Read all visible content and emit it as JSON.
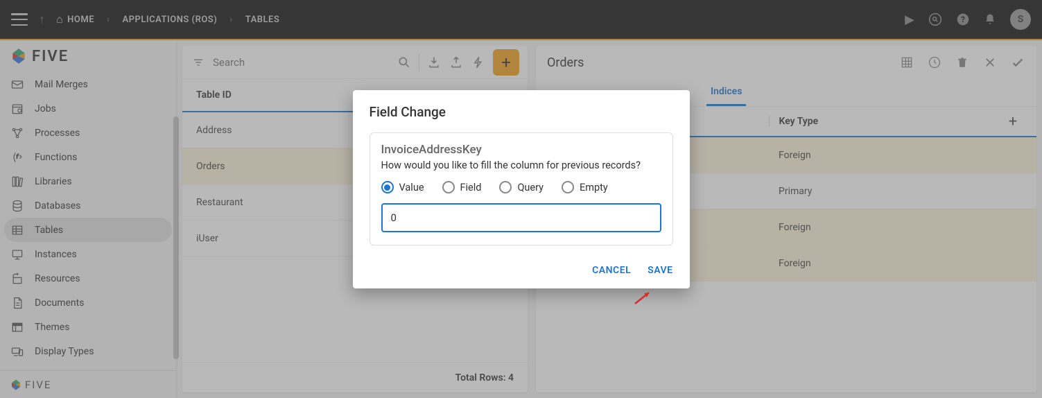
{
  "topbar": {
    "home_label": "HOME",
    "app_label": "APPLICATIONS (ROS)",
    "tables_label": "TABLES",
    "avatar_initial": "S"
  },
  "brand": {
    "name": "FIVE"
  },
  "sidebar": {
    "items": [
      {
        "label": "Mail Merges",
        "icon": "mail-merge-icon"
      },
      {
        "label": "Jobs",
        "icon": "jobs-icon"
      },
      {
        "label": "Processes",
        "icon": "processes-icon"
      },
      {
        "label": "Functions",
        "icon": "functions-icon"
      },
      {
        "label": "Libraries",
        "icon": "libraries-icon"
      },
      {
        "label": "Databases",
        "icon": "databases-icon"
      },
      {
        "label": "Tables",
        "icon": "tables-icon",
        "active": true
      },
      {
        "label": "Instances",
        "icon": "instances-icon"
      },
      {
        "label": "Resources",
        "icon": "resources-icon"
      },
      {
        "label": "Documents",
        "icon": "documents-icon"
      },
      {
        "label": "Themes",
        "icon": "themes-icon"
      },
      {
        "label": "Display Types",
        "icon": "display-types-icon"
      }
    ]
  },
  "left_panel": {
    "search_placeholder": "Search",
    "column_header": "Table ID",
    "rows": [
      {
        "label": "Address"
      },
      {
        "label": "Orders",
        "selected": true
      },
      {
        "label": "Restaurant"
      },
      {
        "label": "iUser"
      }
    ],
    "footer_label": "Total Rows:",
    "footer_count": "4"
  },
  "right_panel": {
    "title": "Orders",
    "tabs": [
      {
        "label": "Indices",
        "active": true
      }
    ],
    "column_header": "Key Type",
    "rows": [
      {
        "key_type": "Foreign",
        "hl": true
      },
      {
        "key_type": "Primary"
      },
      {
        "key_type": "Foreign",
        "hl": true
      },
      {
        "key_type": "Foreign",
        "hl": true
      }
    ]
  },
  "modal": {
    "title": "Field Change",
    "field_name": "InvoiceAddressKey",
    "prompt": "How would you like to fill the column for previous records?",
    "options": [
      {
        "label": "Value",
        "checked": true
      },
      {
        "label": "Field"
      },
      {
        "label": "Query"
      },
      {
        "label": "Empty"
      }
    ],
    "value_input": "0",
    "cancel_label": "CANCEL",
    "save_label": "SAVE"
  }
}
